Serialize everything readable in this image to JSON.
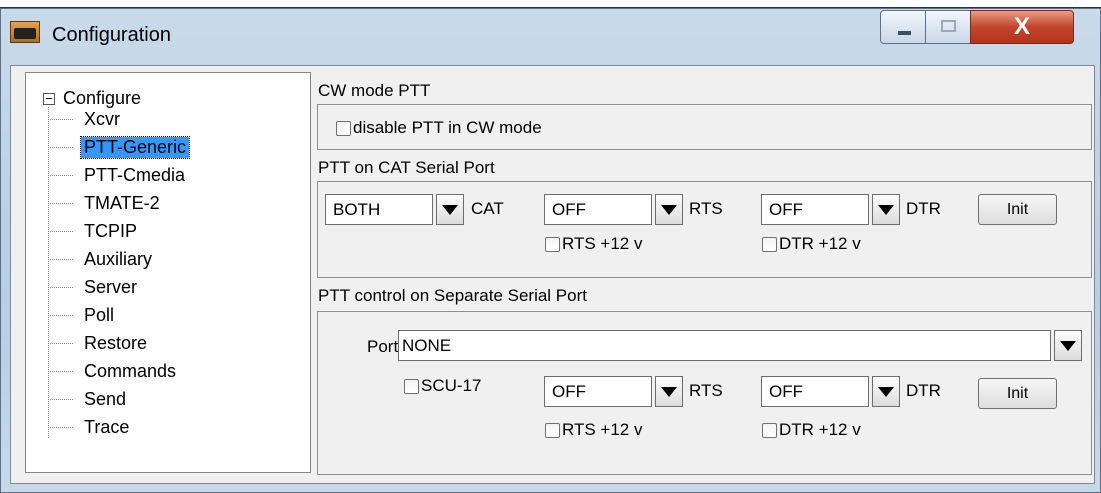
{
  "window": {
    "title": "Configuration",
    "close_glyph": "X"
  },
  "tree": {
    "root_label": "Configure",
    "items": [
      {
        "label": "Xcvr"
      },
      {
        "label": "PTT-Generic"
      },
      {
        "label": "PTT-Cmedia"
      },
      {
        "label": "TMATE-2"
      },
      {
        "label": "TCPIP"
      },
      {
        "label": "Auxiliary"
      },
      {
        "label": "Server"
      },
      {
        "label": "Poll"
      },
      {
        "label": "Restore"
      },
      {
        "label": "Commands"
      },
      {
        "label": "Send"
      },
      {
        "label": "Trace"
      }
    ],
    "selected": "PTT-Generic"
  },
  "cw": {
    "title": "CW mode PTT",
    "disable_label": "disable PTT in CW mode"
  },
  "cat": {
    "title": "PTT on CAT Serial Port",
    "cat_value": "BOTH",
    "cat_label": "CAT",
    "rts_value": "OFF",
    "rts_label": "RTS",
    "dtr_value": "OFF",
    "dtr_label": "DTR",
    "init_label": "Init",
    "rts12_label": "RTS +12 v",
    "dtr12_label": "DTR +12 v"
  },
  "sep": {
    "title": "PTT control on Separate Serial Port",
    "port_label": "Port",
    "port_value": "NONE",
    "scu_label": "SCU-17",
    "rts_value": "OFF",
    "rts_label": "RTS",
    "dtr_value": "OFF",
    "dtr_label": "DTR",
    "init_label": "Init",
    "rts12_label": "RTS +12 v",
    "dtr12_label": "DTR +12 v"
  }
}
